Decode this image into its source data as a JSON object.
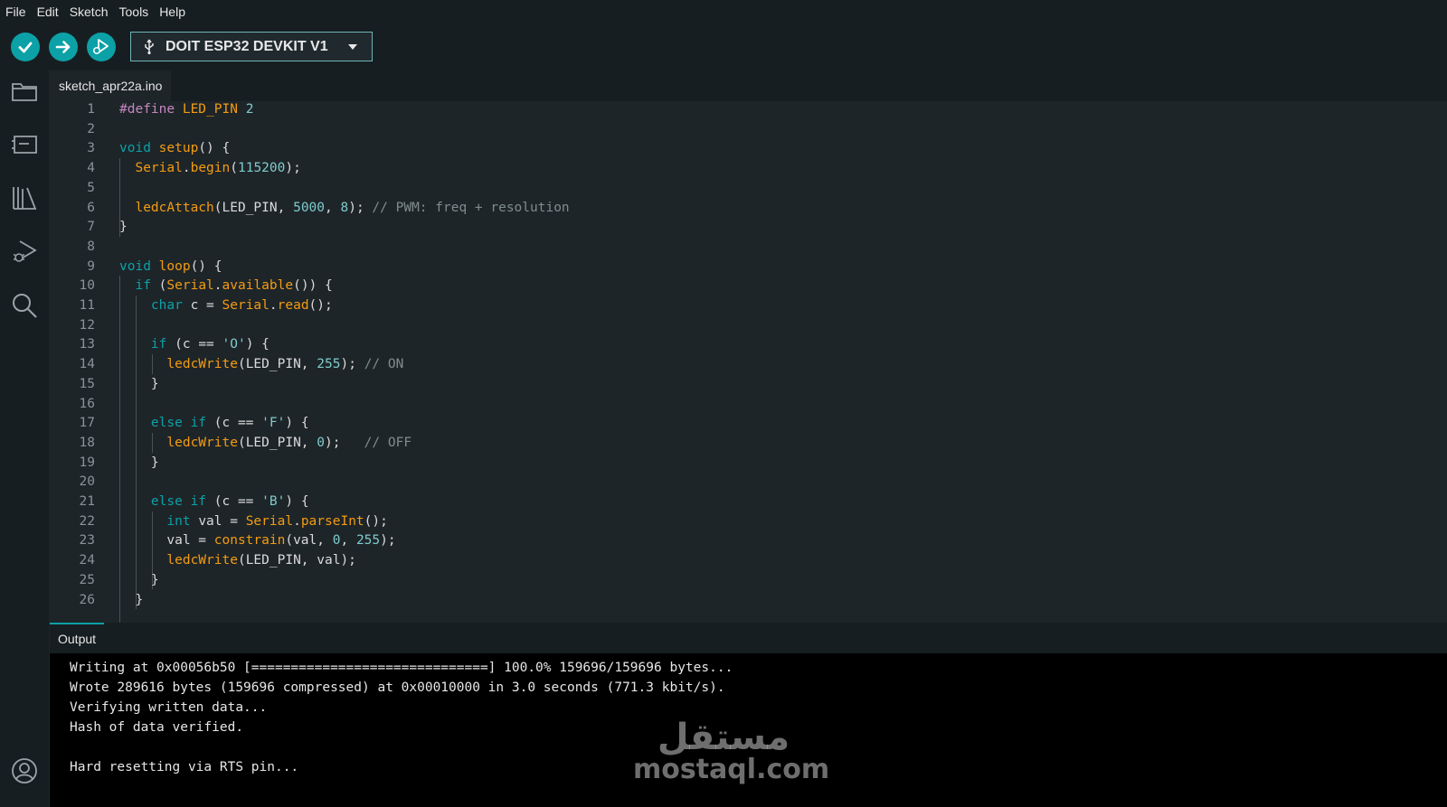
{
  "menu": [
    "File",
    "Edit",
    "Sketch",
    "Tools",
    "Help"
  ],
  "toolbar": {
    "verify_icon": "check-icon",
    "upload_icon": "arrow-right-icon",
    "debug_icon": "debugger-icon",
    "board_label": "DOIT ESP32 DEVKIT V1",
    "board_icon": "usb-icon"
  },
  "sidebar": [
    "folder-icon",
    "board-manager-icon",
    "library-icon",
    "debug-icon",
    "search-icon",
    "account-icon"
  ],
  "tab": {
    "filename": "sketch_apr22a.ino"
  },
  "editor": {
    "line_numbers": [
      "1",
      "2",
      "3",
      "4",
      "5",
      "6",
      "7",
      "8",
      "9",
      "10",
      "11",
      "12",
      "13",
      "14",
      "15",
      "16",
      "17",
      "18",
      "19",
      "20",
      "21",
      "22",
      "23",
      "24",
      "25",
      "26"
    ]
  },
  "code_lines": [
    [
      [
        "pp",
        "#define "
      ],
      [
        "cls",
        "LED_PIN "
      ],
      [
        "num",
        "2"
      ]
    ],
    [],
    [
      [
        "kw",
        "void "
      ],
      [
        "fn",
        "setup"
      ],
      [
        "txt",
        "() {"
      ]
    ],
    [
      [
        "txt",
        "  "
      ],
      [
        "cls",
        "Serial"
      ],
      [
        "txt",
        "."
      ],
      [
        "fn",
        "begin"
      ],
      [
        "txt",
        "("
      ],
      [
        "num",
        "115200"
      ],
      [
        "txt",
        ");"
      ]
    ],
    [],
    [
      [
        "txt",
        "  "
      ],
      [
        "fn",
        "ledcAttach"
      ],
      [
        "txt",
        "(LED_PIN, "
      ],
      [
        "num",
        "5000"
      ],
      [
        "txt",
        ", "
      ],
      [
        "num",
        "8"
      ],
      [
        "txt",
        "); "
      ],
      [
        "cmt",
        "// PWM: freq + resolution"
      ]
    ],
    [
      [
        "txt",
        "}"
      ]
    ],
    [],
    [
      [
        "kw",
        "void "
      ],
      [
        "fn",
        "loop"
      ],
      [
        "txt",
        "() {"
      ]
    ],
    [
      [
        "txt",
        "  "
      ],
      [
        "kw",
        "if "
      ],
      [
        "txt",
        "("
      ],
      [
        "cls",
        "Serial"
      ],
      [
        "txt",
        "."
      ],
      [
        "fn",
        "available"
      ],
      [
        "txt",
        "()) {"
      ]
    ],
    [
      [
        "txt",
        "    "
      ],
      [
        "kw",
        "char "
      ],
      [
        "txt",
        "c = "
      ],
      [
        "cls",
        "Serial"
      ],
      [
        "txt",
        "."
      ],
      [
        "fn",
        "read"
      ],
      [
        "txt",
        "();"
      ]
    ],
    [],
    [
      [
        "txt",
        "    "
      ],
      [
        "kw",
        "if "
      ],
      [
        "txt",
        "(c == "
      ],
      [
        "str",
        "'O'"
      ],
      [
        "txt",
        ") {"
      ]
    ],
    [
      [
        "txt",
        "      "
      ],
      [
        "fn",
        "ledcWrite"
      ],
      [
        "txt",
        "(LED_PIN, "
      ],
      [
        "num",
        "255"
      ],
      [
        "txt",
        "); "
      ],
      [
        "cmt",
        "// ON"
      ]
    ],
    [
      [
        "txt",
        "    }"
      ]
    ],
    [],
    [
      [
        "txt",
        "    "
      ],
      [
        "kw",
        "else if "
      ],
      [
        "txt",
        "(c == "
      ],
      [
        "str",
        "'F'"
      ],
      [
        "txt",
        ") {"
      ]
    ],
    [
      [
        "txt",
        "      "
      ],
      [
        "fn",
        "ledcWrite"
      ],
      [
        "txt",
        "(LED_PIN, "
      ],
      [
        "num",
        "0"
      ],
      [
        "txt",
        ");   "
      ],
      [
        "cmt",
        "// OFF"
      ]
    ],
    [
      [
        "txt",
        "    }"
      ]
    ],
    [],
    [
      [
        "txt",
        "    "
      ],
      [
        "kw",
        "else if "
      ],
      [
        "txt",
        "(c == "
      ],
      [
        "str",
        "'B'"
      ],
      [
        "txt",
        ") {"
      ]
    ],
    [
      [
        "txt",
        "      "
      ],
      [
        "kw",
        "int "
      ],
      [
        "txt",
        "val = "
      ],
      [
        "cls",
        "Serial"
      ],
      [
        "txt",
        "."
      ],
      [
        "fn",
        "parseInt"
      ],
      [
        "txt",
        "();"
      ]
    ],
    [
      [
        "txt",
        "      val = "
      ],
      [
        "fn",
        "constrain"
      ],
      [
        "txt",
        "(val, "
      ],
      [
        "num",
        "0"
      ],
      [
        "txt",
        ", "
      ],
      [
        "num",
        "255"
      ],
      [
        "txt",
        ");"
      ]
    ],
    [
      [
        "txt",
        "      "
      ],
      [
        "fn",
        "ledcWrite"
      ],
      [
        "txt",
        "(LED_PIN, val);"
      ]
    ],
    [
      [
        "txt",
        "    }"
      ]
    ],
    [
      [
        "txt",
        "  }"
      ]
    ]
  ],
  "output": {
    "title": "Output",
    "lines": [
      "Writing at 0x00056b50 [==============================] 100.0% 159696/159696 bytes...",
      "Wrote 289616 bytes (159696 compressed) at 0x00010000 in 3.0 seconds (771.3 kbit/s).",
      "Verifying written data...",
      "Hash of data verified.",
      "",
      "Hard resetting via RTS pin..."
    ]
  },
  "watermark": {
    "arabic": "مستقل",
    "latin": "mostaql.com"
  }
}
